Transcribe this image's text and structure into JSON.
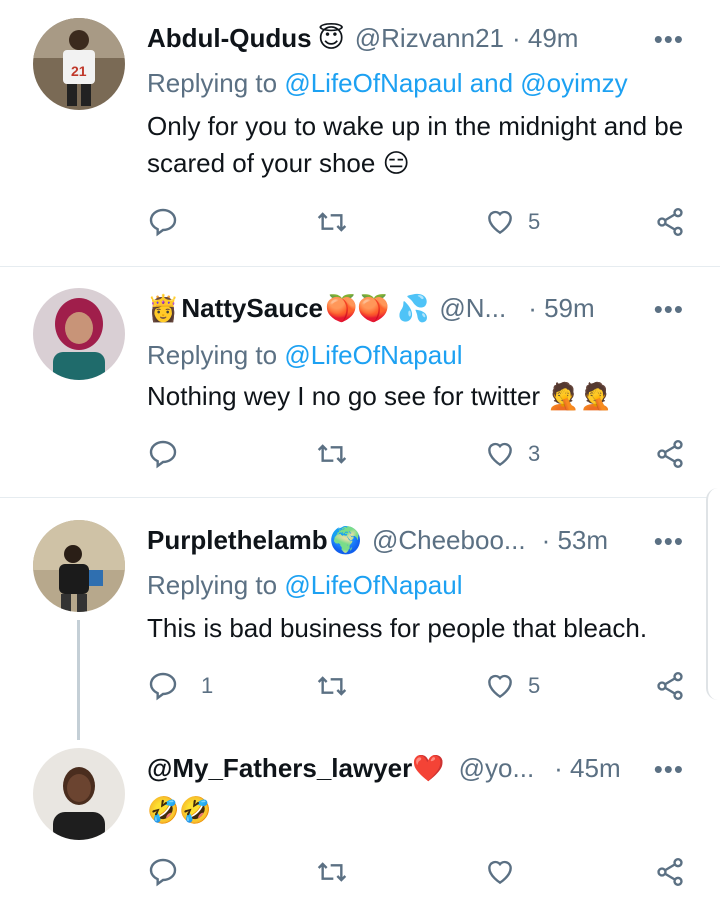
{
  "tweets": [
    {
      "name": "Abdul-Qudus",
      "emoji": "😇",
      "handle": "@Rizvann21",
      "time": "· 49m",
      "reply_prefix": "Replying to ",
      "reply_to": "@LifeOfNapaul and @oyimzy",
      "text": "Only for you to wake up in the midnight and be scared of your shoe 😑",
      "replies": "",
      "likes": "5"
    },
    {
      "name": "NattySauce",
      "emoji_prefix": "👸",
      "emoji": "🍑🍑 💦",
      "handle": "@N...",
      "time": "· 59m",
      "reply_prefix": "Replying to ",
      "reply_to": "@LifeOfNapaul",
      "text": "Nothing wey I no go see for twitter 🤦🤦",
      "replies": "",
      "likes": "3"
    },
    {
      "name": "Purplethelamb",
      "emoji": "🌍",
      "handle": "@Cheeboo...",
      "time": "· 53m",
      "reply_prefix": "Replying to ",
      "reply_to": "@LifeOfNapaul",
      "text": "This is bad business for people that bleach.",
      "replies": "1",
      "likes": "5"
    },
    {
      "name": "@My_Fathers_lawyer",
      "emoji": "❤️",
      "handle": "@yo...",
      "time": "· 45m",
      "text": "🤣🤣",
      "replies": "",
      "likes": ""
    }
  ],
  "more_label": "•••",
  "colors": {
    "accent": "#1da1f2",
    "muted": "#5b7083",
    "text": "#0f1419",
    "divider": "#e6ecf0"
  },
  "icons": [
    "reply-icon",
    "retweet-icon",
    "like-icon",
    "share-icon",
    "more-icon"
  ]
}
